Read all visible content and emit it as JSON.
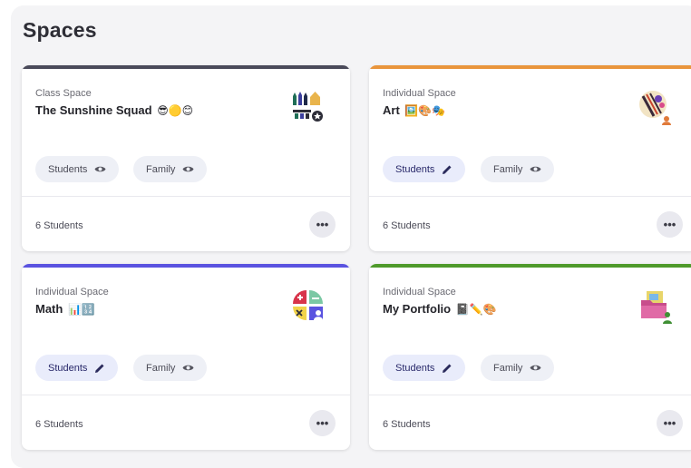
{
  "page": {
    "title": "Spaces"
  },
  "cards": [
    {
      "type": "Class Space",
      "name": "The Sunshine Squad",
      "emoji": "😎🟡😊",
      "students_label": "Students",
      "family_label": "Family",
      "count": "6 Students",
      "more_label": "•••",
      "accent": "#4a4a5a"
    },
    {
      "type": "Individual Space",
      "name": "Art",
      "emoji": "🖼️🎨🎭",
      "students_label": "Students",
      "family_label": "Family",
      "count": "6 Students",
      "more_label": "•••",
      "accent": "#e9953c"
    },
    {
      "type": "Individual Space",
      "name": "Math",
      "emoji": "📊🔢",
      "students_label": "Students",
      "family_label": "Family",
      "count": "6 Students",
      "more_label": "•••",
      "accent": "#5a53e0"
    },
    {
      "type": "Individual Space",
      "name": "My Portfolio",
      "emoji": "📓✏️🎨",
      "students_label": "Students",
      "family_label": "Family",
      "count": "6 Students",
      "more_label": "•••",
      "accent": "#4f9a2b"
    }
  ]
}
